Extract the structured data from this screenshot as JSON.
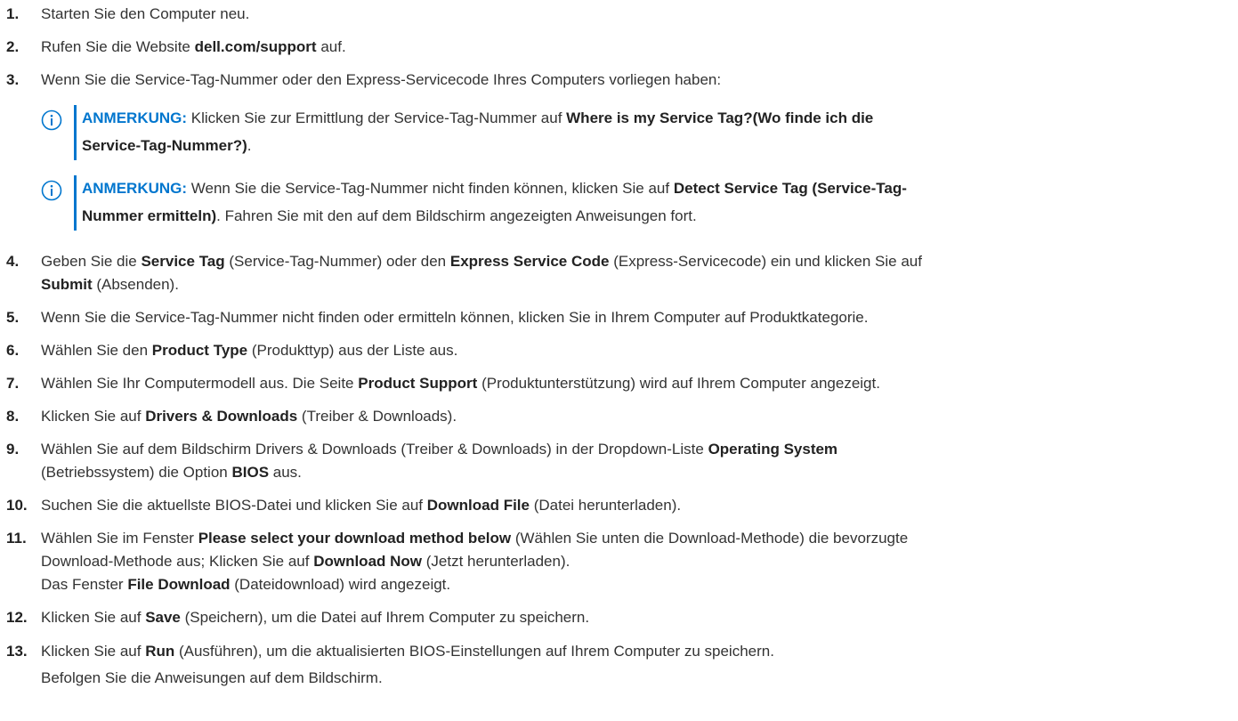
{
  "steps": [
    {
      "num": "1.",
      "lines": [
        [
          {
            "t": "Starten Sie den Computer neu."
          }
        ]
      ]
    },
    {
      "num": "2.",
      "lines": [
        [
          {
            "t": "Rufen Sie die Website "
          },
          {
            "t": "dell.com/support",
            "b": true
          },
          {
            "t": " auf."
          }
        ]
      ]
    },
    {
      "num": "3.",
      "lines": [
        [
          {
            "t": "Wenn Sie die Service-Tag-Nummer oder den Express-Servicecode Ihres Computers vorliegen haben:"
          }
        ]
      ]
    },
    {
      "num": "4.",
      "lines": [
        [
          {
            "t": "Geben Sie die "
          },
          {
            "t": "Service Tag",
            "b": true
          },
          {
            "t": " (Service-Tag-Nummer) oder den "
          },
          {
            "t": "Express Service Code",
            "b": true
          },
          {
            "t": " (Express-Servicecode) ein und klicken Sie auf"
          }
        ],
        [
          {
            "t": "Submit",
            "b": true
          },
          {
            "t": " (Absenden)."
          }
        ]
      ]
    },
    {
      "num": "5.",
      "lines": [
        [
          {
            "t": "Wenn Sie die Service-Tag-Nummer nicht finden oder ermitteln können, klicken Sie in Ihrem Computer auf Produktkategorie."
          }
        ]
      ]
    },
    {
      "num": "6.",
      "lines": [
        [
          {
            "t": "Wählen Sie den "
          },
          {
            "t": "Product Type",
            "b": true
          },
          {
            "t": " (Produkttyp) aus der Liste aus."
          }
        ]
      ]
    },
    {
      "num": "7.",
      "lines": [
        [
          {
            "t": "Wählen Sie Ihr Computermodell aus. Die Seite "
          },
          {
            "t": "Product Support",
            "b": true
          },
          {
            "t": " (Produktunterstützung) wird auf Ihrem Computer angezeigt."
          }
        ]
      ]
    },
    {
      "num": "8.",
      "lines": [
        [
          {
            "t": "Klicken Sie auf "
          },
          {
            "t": "Drivers & Downloads",
            "b": true
          },
          {
            "t": " (Treiber & Downloads)."
          }
        ]
      ]
    },
    {
      "num": "9.",
      "lines": [
        [
          {
            "t": "Wählen Sie auf dem Bildschirm Drivers & Downloads (Treiber & Downloads) in der Dropdown-Liste "
          },
          {
            "t": "Operating System",
            "b": true
          }
        ],
        [
          {
            "t": "(Betriebssystem) die Option "
          },
          {
            "t": "BIOS",
            "b": true
          },
          {
            "t": " aus."
          }
        ]
      ]
    },
    {
      "num": "10.",
      "lines": [
        [
          {
            "t": "Suchen Sie die aktuellste BIOS-Datei und klicken Sie auf "
          },
          {
            "t": "Download File",
            "b": true
          },
          {
            "t": " (Datei herunterladen)."
          }
        ]
      ]
    },
    {
      "num": "11.",
      "lines": [
        [
          {
            "t": "Wählen Sie im Fenster "
          },
          {
            "t": "Please select your download method below",
            "b": true
          },
          {
            "t": " (Wählen Sie unten die Download-Methode) die bevorzugte"
          }
        ],
        [
          {
            "t": "Download-Methode aus; Klicken Sie auf "
          },
          {
            "t": "Download Now",
            "b": true
          },
          {
            "t": " (Jetzt herunterladen)."
          }
        ],
        [
          {
            "t": "Das Fenster "
          },
          {
            "t": "File Download",
            "b": true
          },
          {
            "t": " (Dateidownload) wird angezeigt."
          }
        ]
      ]
    },
    {
      "num": "12.",
      "lines": [
        [
          {
            "t": "Klicken Sie auf "
          },
          {
            "t": "Save",
            "b": true
          },
          {
            "t": " (Speichern), um die Datei auf Ihrem Computer zu speichern."
          }
        ]
      ]
    },
    {
      "num": "13.",
      "lines": [
        [
          {
            "t": "Klicken Sie auf "
          },
          {
            "t": "Run",
            "b": true
          },
          {
            "t": " (Ausführen), um die aktualisierten BIOS-Einstellungen auf Ihrem Computer zu speichern."
          }
        ],
        [
          {
            "t": "Befolgen Sie die Anweisungen auf dem Bildschirm."
          }
        ]
      ]
    }
  ],
  "notes": [
    {
      "lines": [
        [
          {
            "t": "ANMERKUNG:",
            "label": true
          },
          {
            "t": " Klicken Sie zur Ermittlung der Service-Tag-Nummer auf "
          },
          {
            "t": "Where is my Service Tag?(Wo finde ich die",
            "b": true
          }
        ],
        [
          {
            "t": "Service-Tag-Nummer?)",
            "b": true
          },
          {
            "t": "."
          }
        ]
      ]
    },
    {
      "lines": [
        [
          {
            "t": "ANMERKUNG:",
            "label": true
          },
          {
            "t": " Wenn Sie die Service-Tag-Nummer nicht finden können, klicken Sie auf "
          },
          {
            "t": "Detect Service Tag (Service-Tag-",
            "b": true
          }
        ],
        [
          {
            "t": "Nummer ermitteln)",
            "b": true
          },
          {
            "t": ". Fahren Sie mit den auf dem Bildschirm angezeigten Anweisungen fort."
          }
        ]
      ]
    }
  ],
  "colors": {
    "accent": "#0076ce",
    "text": "#333333"
  },
  "icons": {
    "note": "info-icon"
  }
}
